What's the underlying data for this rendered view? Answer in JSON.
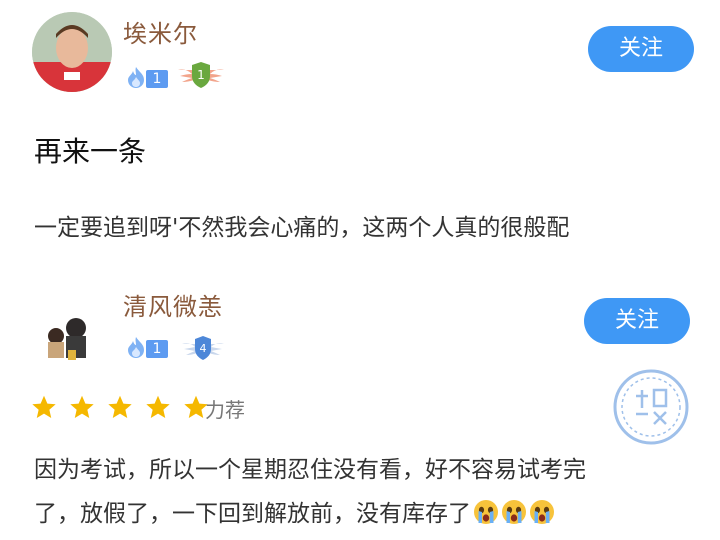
{
  "comments": [
    {
      "username": "埃米尔",
      "level": "1",
      "rank": "1",
      "follow_label": "关注",
      "title": "再来一条",
      "text": "一定要追到呀'不然我会心痛的，这两个人真的很般配"
    },
    {
      "username": "清风微恙",
      "level": "1",
      "rank": "4",
      "follow_label": "关注",
      "rating": 5,
      "rating_label": "力荐",
      "text_lines": [
        "因为考试，所以一个星期忍住没有看，好不容易试考完",
        "了，放假了，一下回到解放前，没有库存了"
      ],
      "emoji": [
        "crying-face-icon",
        "crying-face-icon",
        "crying-face-icon"
      ]
    }
  ],
  "colors": {
    "accent": "#3f98f5",
    "username": "#8a5a3c",
    "star": "#f5b800",
    "level_badge": "#5d9bf1"
  }
}
